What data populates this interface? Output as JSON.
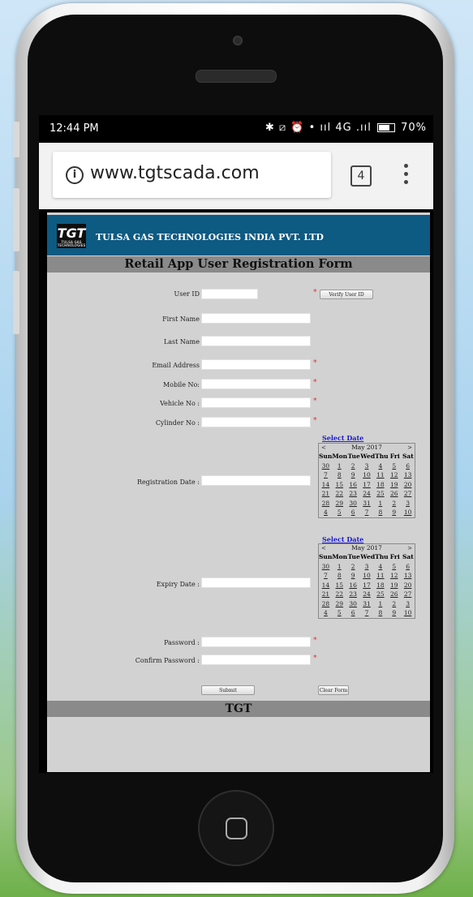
{
  "status_bar": {
    "time": "12:44 PM",
    "icons": "✱ ⧄ ⏰ • ııl 4G .ııl",
    "battery": "70%"
  },
  "browser": {
    "url": "www.tgtscada.com",
    "tab_count": "4"
  },
  "header": {
    "logo_text": "TGT",
    "logo_sub": "TULSA GAS TECHNOLOGIES",
    "company": "TULSA GAS TECHNOLOGIES INDIA PVT. LTD"
  },
  "form": {
    "title": "Retail App User Registration Form",
    "fields": {
      "user_id": "User ID",
      "first_name": "First Name",
      "last_name": "Last Name",
      "email": "Email Address",
      "mobile": "Mobile No:",
      "vehicle": "Vehicle No :",
      "cylinder": "Cylinder No :",
      "registration_date": "Registration Date :",
      "expiry_date": "Expiry Date :",
      "password": "Password :",
      "confirm_password": "Confirm Password :"
    },
    "required_mark": "*",
    "verify_button": "Verify User ID",
    "submit_button": "Submit",
    "clear_button": "Clear Form"
  },
  "calendar": {
    "select_date": "Select Date",
    "month": "May 2017",
    "prev": "<",
    "next": ">",
    "day_names": [
      "Sun",
      "Mon",
      "Tue",
      "Wed",
      "Thu",
      "Fri",
      "Sat"
    ],
    "weeks": [
      [
        "30",
        "1",
        "2",
        "3",
        "4",
        "5",
        "6"
      ],
      [
        "7",
        "8",
        "9",
        "10",
        "11",
        "12",
        "13"
      ],
      [
        "14",
        "15",
        "16",
        "17",
        "18",
        "19",
        "20"
      ],
      [
        "21",
        "22",
        "23",
        "24",
        "25",
        "26",
        "27"
      ],
      [
        "28",
        "29",
        "30",
        "31",
        "1",
        "2",
        "3"
      ],
      [
        "4",
        "5",
        "6",
        "7",
        "8",
        "9",
        "10"
      ]
    ]
  },
  "footer": {
    "text": "TGT"
  }
}
